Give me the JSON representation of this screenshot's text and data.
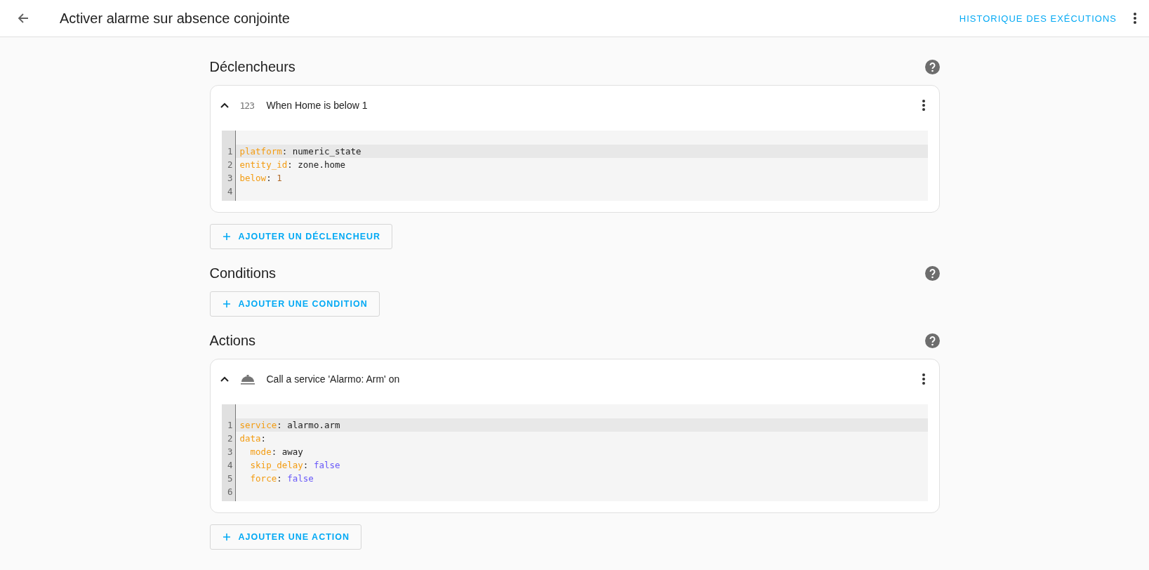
{
  "header": {
    "title": "Activer alarme sur absence conjointe",
    "action": "HISTORIQUE DES EXÉCUTIONS"
  },
  "sections": [
    {
      "title": "Déclencheurs",
      "cards": [
        {
          "icon": {
            "kind": "text",
            "text": "123"
          },
          "title": "When Home is below 1",
          "expanded": true,
          "lines": [
            {
              "number": "1",
              "active": true,
              "tokens": [
                {
                  "kind": "key",
                  "text": "platform"
                },
                {
                  "kind": "punct",
                  "text": ": "
                },
                {
                  "kind": "string",
                  "text": "numeric_state"
                }
              ]
            },
            {
              "number": "2",
              "active": false,
              "tokens": [
                {
                  "kind": "key",
                  "text": "entity_id"
                },
                {
                  "kind": "punct",
                  "text": ": "
                },
                {
                  "kind": "string",
                  "text": "zone.home"
                }
              ]
            },
            {
              "number": "3",
              "active": false,
              "tokens": [
                {
                  "kind": "key",
                  "text": "below"
                },
                {
                  "kind": "punct",
                  "text": ": "
                },
                {
                  "kind": "number",
                  "text": "1"
                }
              ]
            },
            {
              "number": "4",
              "active": false
            }
          ]
        }
      ],
      "add_button": "AJOUTER UN DÉCLENCHEUR"
    },
    {
      "title": "Conditions",
      "add_button": "AJOUTER UNE CONDITION"
    },
    {
      "title": "Actions",
      "cards": [
        {
          "icon": {
            "kind": "bell"
          },
          "title": "Call a service 'Alarmo: Arm' on",
          "expanded": true,
          "lines": [
            {
              "number": "1",
              "active": true,
              "tokens": [
                {
                  "kind": "key",
                  "text": "service"
                },
                {
                  "kind": "punct",
                  "text": ": "
                },
                {
                  "kind": "string",
                  "text": "alarmo.arm"
                }
              ]
            },
            {
              "number": "2",
              "active": false,
              "tokens": [
                {
                  "kind": "key",
                  "text": "data"
                },
                {
                  "kind": "punct",
                  "text": ":"
                }
              ]
            },
            {
              "number": "3",
              "active": false,
              "tokens": [
                {
                  "kind": "key",
                  "text": "  mode"
                },
                {
                  "kind": "punct",
                  "text": ": "
                },
                {
                  "kind": "string",
                  "text": "away"
                }
              ]
            },
            {
              "number": "4",
              "active": false,
              "tokens": [
                {
                  "kind": "key",
                  "text": "  skip_delay"
                },
                {
                  "kind": "punct",
                  "text": ": "
                },
                {
                  "kind": "bool",
                  "text": "false"
                }
              ]
            },
            {
              "number": "5",
              "active": false,
              "tokens": [
                {
                  "kind": "key",
                  "text": "  force"
                },
                {
                  "kind": "punct",
                  "text": ": "
                },
                {
                  "kind": "bool",
                  "text": "false"
                }
              ]
            },
            {
              "number": "6",
              "active": false
            }
          ]
        }
      ],
      "add_button": "AJOUTER UNE ACTION"
    }
  ]
}
